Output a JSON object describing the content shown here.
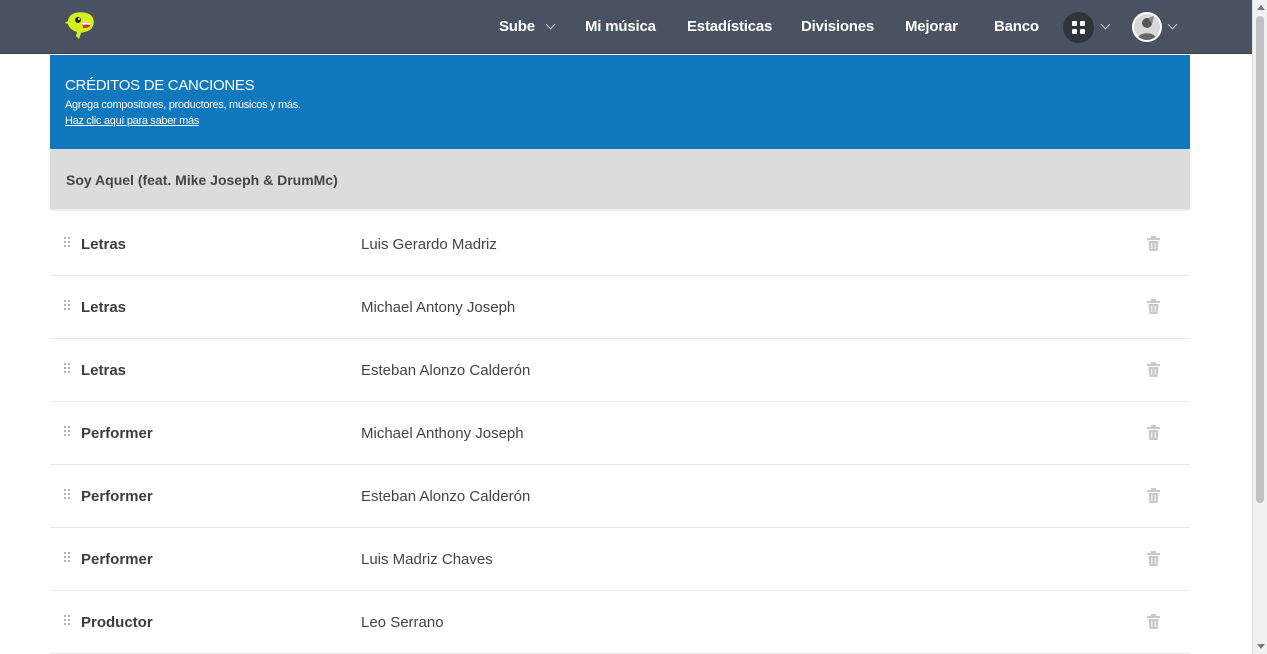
{
  "nav": {
    "items": [
      {
        "label": "Sube",
        "dropdown": true
      },
      {
        "label": "Mi música",
        "dropdown": false
      },
      {
        "label": "Estadísticas",
        "dropdown": false
      },
      {
        "label": "Divisiones",
        "dropdown": false
      },
      {
        "label": "Mejorar",
        "dropdown": false
      },
      {
        "label": "Banco",
        "dropdown": false
      }
    ],
    "icons": {
      "logo": "mascot-logo-icon",
      "apps": "apps-grid-icon",
      "avatar": "user-avatar"
    },
    "colors": {
      "background": "#4a5160",
      "logo": "#d4f01e"
    }
  },
  "banner": {
    "title": "CRÉDITOS DE CANCIONES",
    "subtitle": "Agrega compositores, productores, músicos y más.",
    "link": "Haz clic aquí para saber más",
    "color": "#1078bc"
  },
  "song": {
    "title": "Soy Aquel (feat. Mike Joseph & DrumMc)"
  },
  "credits": [
    {
      "role": "Letras",
      "name": "Luis Gerardo Madriz"
    },
    {
      "role": "Letras",
      "name": "Michael Antony Joseph"
    },
    {
      "role": "Letras",
      "name": "Esteban Alonzo Calderón"
    },
    {
      "role": "Performer",
      "name": "Michael Anthony Joseph"
    },
    {
      "role": "Performer",
      "name": "Esteban Alonzo Calderón"
    },
    {
      "role": "Performer",
      "name": "Luis Madriz Chaves"
    },
    {
      "role": "Productor",
      "name": "Leo Serrano"
    }
  ]
}
